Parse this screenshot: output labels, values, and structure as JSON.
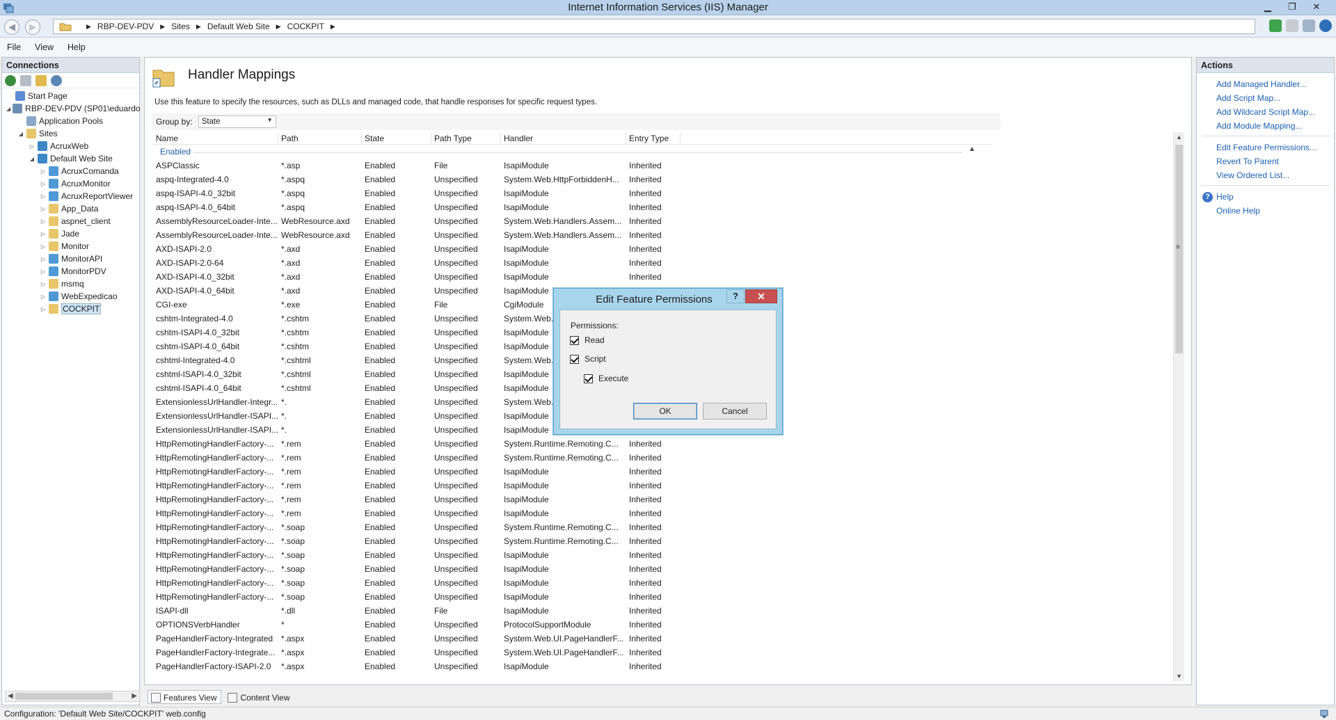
{
  "window": {
    "title": "Internet Information Services (IIS) Manager"
  },
  "breadcrumb": [
    "RBP-DEV-PDV",
    "Sites",
    "Default Web Site",
    "COCKPIT"
  ],
  "menu": [
    "File",
    "View",
    "Help"
  ],
  "connections": {
    "title": "Connections",
    "tree": [
      {
        "label": "Start Page",
        "depth": 0,
        "exp": "",
        "icon": "start-page-icon",
        "color": "#5c8bd6"
      },
      {
        "label": "RBP-DEV-PDV (SP01\\eduardo",
        "depth": 0,
        "exp": "◢",
        "icon": "server-icon",
        "color": "#6a8fb5"
      },
      {
        "label": "Application Pools",
        "depth": 1,
        "exp": "",
        "icon": "app-pools-icon",
        "color": "#8aa8c9"
      },
      {
        "label": "Sites",
        "depth": 1,
        "exp": "◢",
        "icon": "sites-folder-icon",
        "color": "#e7c56a"
      },
      {
        "label": "AcruxWeb",
        "depth": 2,
        "exp": "▷",
        "icon": "globe-icon",
        "color": "#3d86c8"
      },
      {
        "label": "Default Web Site",
        "depth": 2,
        "exp": "◢",
        "icon": "globe-icon",
        "color": "#3d86c8"
      },
      {
        "label": "AcruxComanda",
        "depth": 3,
        "exp": "▷",
        "icon": "web-app-icon",
        "color": "#4f9ad6"
      },
      {
        "label": "AcruxMonitor",
        "depth": 3,
        "exp": "▷",
        "icon": "web-app-icon",
        "color": "#4f9ad6"
      },
      {
        "label": "AcruxReportViewer",
        "depth": 3,
        "exp": "▷",
        "icon": "web-app-icon",
        "color": "#4f9ad6"
      },
      {
        "label": "App_Data",
        "depth": 3,
        "exp": "▷",
        "icon": "folder-icon",
        "color": "#e9c66b"
      },
      {
        "label": "aspnet_client",
        "depth": 3,
        "exp": "▷",
        "icon": "folder-icon",
        "color": "#e9c66b"
      },
      {
        "label": "Jade",
        "depth": 3,
        "exp": "▷",
        "icon": "folder-icon",
        "color": "#e9c66b"
      },
      {
        "label": "Monitor",
        "depth": 3,
        "exp": "▷",
        "icon": "folder-icon",
        "color": "#e9c66b"
      },
      {
        "label": "MonitorAPI",
        "depth": 3,
        "exp": "▷",
        "icon": "web-app-icon",
        "color": "#4f9ad6"
      },
      {
        "label": "MonitorPDV",
        "depth": 3,
        "exp": "▷",
        "icon": "web-app-icon",
        "color": "#4f9ad6"
      },
      {
        "label": "msmq",
        "depth": 3,
        "exp": "▷",
        "icon": "folder-icon",
        "color": "#e9c66b"
      },
      {
        "label": "WebExpedicao",
        "depth": 3,
        "exp": "▷",
        "icon": "web-app-icon",
        "color": "#4f9ad6"
      },
      {
        "label": "COCKPIT",
        "depth": 3,
        "exp": "▷",
        "icon": "folder-icon",
        "color": "#e9c66b",
        "selected": true
      }
    ]
  },
  "feature": {
    "title": "Handler Mappings",
    "description": "Use this feature to specify the resources, such as DLLs and managed code, that handle responses for specific request types.",
    "group_by_label": "Group by:",
    "group_by_value": "State",
    "group_name": "Enabled",
    "columns": [
      {
        "label": "Name",
        "width": 180
      },
      {
        "label": "Path",
        "width": 120
      },
      {
        "label": "State",
        "width": 100
      },
      {
        "label": "Path Type",
        "width": 100
      },
      {
        "label": "Handler",
        "width": 180
      },
      {
        "label": "Entry Type",
        "width": 78
      }
    ],
    "rows": [
      [
        "ASPClassic",
        "*.asp",
        "Enabled",
        "File",
        "IsapiModule",
        "Inherited"
      ],
      [
        "aspq-Integrated-4.0",
        "*.aspq",
        "Enabled",
        "Unspecified",
        "System.Web.HttpForbiddenH...",
        "Inherited"
      ],
      [
        "aspq-ISAPI-4.0_32bit",
        "*.aspq",
        "Enabled",
        "Unspecified",
        "IsapiModule",
        "Inherited"
      ],
      [
        "aspq-ISAPI-4.0_64bit",
        "*.aspq",
        "Enabled",
        "Unspecified",
        "IsapiModule",
        "Inherited"
      ],
      [
        "AssemblyResourceLoader-Inte...",
        "WebResource.axd",
        "Enabled",
        "Unspecified",
        "System.Web.Handlers.Assem...",
        "Inherited"
      ],
      [
        "AssemblyResourceLoader-Inte...",
        "WebResource.axd",
        "Enabled",
        "Unspecified",
        "System.Web.Handlers.Assem...",
        "Inherited"
      ],
      [
        "AXD-ISAPI-2.0",
        "*.axd",
        "Enabled",
        "Unspecified",
        "IsapiModule",
        "Inherited"
      ],
      [
        "AXD-ISAPI-2.0-64",
        "*.axd",
        "Enabled",
        "Unspecified",
        "IsapiModule",
        "Inherited"
      ],
      [
        "AXD-ISAPI-4.0_32bit",
        "*.axd",
        "Enabled",
        "Unspecified",
        "IsapiModule",
        "Inherited"
      ],
      [
        "AXD-ISAPI-4.0_64bit",
        "*.axd",
        "Enabled",
        "Unspecified",
        "IsapiModule",
        "Inherited"
      ],
      [
        "CGI-exe",
        "*.exe",
        "Enabled",
        "File",
        "CgiModule",
        "Inherited"
      ],
      [
        "cshtm-Integrated-4.0",
        "*.cshtm",
        "Enabled",
        "Unspecified",
        "System.Web.",
        ""
      ],
      [
        "cshtm-ISAPI-4.0_32bit",
        "*.cshtm",
        "Enabled",
        "Unspecified",
        "IsapiModule",
        ""
      ],
      [
        "cshtm-ISAPI-4.0_64bit",
        "*.cshtm",
        "Enabled",
        "Unspecified",
        "IsapiModule",
        ""
      ],
      [
        "cshtml-Integrated-4.0",
        "*.cshtml",
        "Enabled",
        "Unspecified",
        "System.Web.",
        ""
      ],
      [
        "cshtml-ISAPI-4.0_32bit",
        "*.cshtml",
        "Enabled",
        "Unspecified",
        "IsapiModule",
        ""
      ],
      [
        "cshtml-ISAPI-4.0_64bit",
        "*.cshtml",
        "Enabled",
        "Unspecified",
        "IsapiModule",
        ""
      ],
      [
        "ExtensionlessUrlHandler-Integr...",
        "*.",
        "Enabled",
        "Unspecified",
        "System.Web.",
        ""
      ],
      [
        "ExtensionlessUrlHandler-ISAPI...",
        "*.",
        "Enabled",
        "Unspecified",
        "IsapiModule",
        ""
      ],
      [
        "ExtensionlessUrlHandler-ISAPI...",
        "*.",
        "Enabled",
        "Unspecified",
        "IsapiModule",
        ""
      ],
      [
        "HttpRemotingHandlerFactory-...",
        "*.rem",
        "Enabled",
        "Unspecified",
        "System.Runtime.Remoting.C...",
        "Inherited"
      ],
      [
        "HttpRemotingHandlerFactory-...",
        "*.rem",
        "Enabled",
        "Unspecified",
        "System.Runtime.Remoting.C...",
        "Inherited"
      ],
      [
        "HttpRemotingHandlerFactory-...",
        "*.rem",
        "Enabled",
        "Unspecified",
        "IsapiModule",
        "Inherited"
      ],
      [
        "HttpRemotingHandlerFactory-...",
        "*.rem",
        "Enabled",
        "Unspecified",
        "IsapiModule",
        "Inherited"
      ],
      [
        "HttpRemotingHandlerFactory-...",
        "*.rem",
        "Enabled",
        "Unspecified",
        "IsapiModule",
        "Inherited"
      ],
      [
        "HttpRemotingHandlerFactory-...",
        "*.rem",
        "Enabled",
        "Unspecified",
        "IsapiModule",
        "Inherited"
      ],
      [
        "HttpRemotingHandlerFactory-...",
        "*.soap",
        "Enabled",
        "Unspecified",
        "System.Runtime.Remoting.C...",
        "Inherited"
      ],
      [
        "HttpRemotingHandlerFactory-...",
        "*.soap",
        "Enabled",
        "Unspecified",
        "System.Runtime.Remoting.C...",
        "Inherited"
      ],
      [
        "HttpRemotingHandlerFactory-...",
        "*.soap",
        "Enabled",
        "Unspecified",
        "IsapiModule",
        "Inherited"
      ],
      [
        "HttpRemotingHandlerFactory-...",
        "*.soap",
        "Enabled",
        "Unspecified",
        "IsapiModule",
        "Inherited"
      ],
      [
        "HttpRemotingHandlerFactory-...",
        "*.soap",
        "Enabled",
        "Unspecified",
        "IsapiModule",
        "Inherited"
      ],
      [
        "HttpRemotingHandlerFactory-...",
        "*.soap",
        "Enabled",
        "Unspecified",
        "IsapiModule",
        "Inherited"
      ],
      [
        "ISAPI-dll",
        "*.dll",
        "Enabled",
        "File",
        "IsapiModule",
        "Inherited"
      ],
      [
        "OPTIONSVerbHandler",
        "*",
        "Enabled",
        "Unspecified",
        "ProtocolSupportModule",
        "Inherited"
      ],
      [
        "PageHandlerFactory-Integrated",
        "*.aspx",
        "Enabled",
        "Unspecified",
        "System.Web.UI.PageHandlerF...",
        "Inherited"
      ],
      [
        "PageHandlerFactory-Integrate...",
        "*.aspx",
        "Enabled",
        "Unspecified",
        "System.Web.UI.PageHandlerF...",
        "Inherited"
      ],
      [
        "PageHandlerFactory-ISAPI-2.0",
        "*.aspx",
        "Enabled",
        "Unspecified",
        "IsapiModule",
        "Inherited"
      ]
    ]
  },
  "views": {
    "features": "Features View",
    "content": "Content View"
  },
  "actions": {
    "title": "Actions",
    "group1": [
      "Add Managed Handler...",
      "Add Script Map...",
      "Add Wildcard Script Map...",
      "Add Module Mapping..."
    ],
    "group2": [
      "Edit Feature Permissions...",
      "Revert To Parent",
      "View Ordered List..."
    ],
    "help": [
      "Help",
      "Online Help"
    ]
  },
  "status": {
    "text": "Configuration: 'Default Web Site/COCKPIT' web.config"
  },
  "dialog": {
    "title": "Edit Feature Permissions",
    "help_glyph": "?",
    "close_glyph": "✕",
    "permissions_label": "Permissions:",
    "read": "Read",
    "script": "Script",
    "execute": "Execute",
    "read_checked": true,
    "script_checked": true,
    "execute_checked": true,
    "ok": "OK",
    "cancel": "Cancel"
  }
}
